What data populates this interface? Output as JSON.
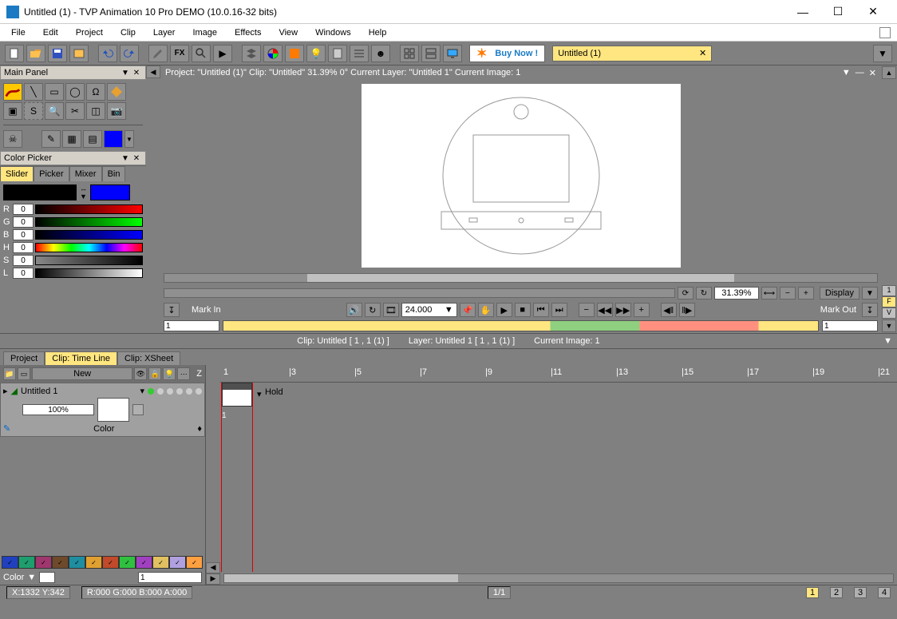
{
  "window": {
    "title": "Untitled (1) - TVP Animation 10 Pro DEMO (10.0.16-32 bits)",
    "min": "—",
    "max": "☐",
    "close": "✕"
  },
  "menus": [
    "File",
    "Edit",
    "Project",
    "Clip",
    "Layer",
    "Image",
    "Effects",
    "View",
    "Windows",
    "Help"
  ],
  "toolbar": {
    "buy_now": "Buy Now !",
    "doc_tab": "Untitled (1)"
  },
  "main_panel": {
    "title": "Main Panel"
  },
  "color_picker": {
    "title": "Color Picker",
    "tabs": [
      "Slider",
      "Picker",
      "Mixer",
      "Bin"
    ],
    "active_tab": "Slider",
    "bg_hex": "#000000",
    "fg_hex": "#0000ff",
    "channels": {
      "R": "0",
      "G": "0",
      "B": "0",
      "H": "0",
      "S": "0",
      "L": "0"
    }
  },
  "canvas": {
    "info": "Project:  \"Untitled (1)\"  Clip: \"Untitled\"   31.39%   0°   Current Layer: \"Untitled 1\"   Current Image: 1",
    "zoom_pct": "31.39%",
    "display_btn": "Display"
  },
  "playbar": {
    "mark_in": "Mark In",
    "mark_out": "Mark Out",
    "fps": "24.000",
    "frame_in": "1",
    "frame_out": "1"
  },
  "infobar": {
    "clip": "Clip: Untitled [ 1 , 1  (1) ]",
    "layer": "Layer: Untitled 1 [ 1 , 1  (1) ]",
    "image": "Current Image: 1"
  },
  "timeline_tabs": [
    "Project",
    "Clip: Time Line",
    "Clip: XSheet"
  ],
  "timeline_active": "Clip: Time Line",
  "layer_panel": {
    "new_btn": "New",
    "z_label": "Z",
    "layer_name": "Untitled 1",
    "opacity": "100%",
    "mode": "Color",
    "hold": "Hold"
  },
  "swatches": [
    "#2040c0",
    "#1e9e6e",
    "#a0366e",
    "#6e4a2a",
    "#1e8ea0",
    "#e0a030",
    "#c04a2a",
    "#30c040",
    "#a040c0",
    "#e0c060",
    "#b0a0e0",
    "#ffa040"
  ],
  "color_row": {
    "label": "Color",
    "value": "1"
  },
  "ruler_ticks": [
    1,
    3,
    5,
    7,
    9,
    11,
    13,
    15,
    17,
    19,
    21
  ],
  "status": {
    "xy": "X:1332  Y:342",
    "rgba": "R:000 G:000 B:000 A:000",
    "frames": "1/1",
    "pages": [
      "1",
      "2",
      "3",
      "4"
    ],
    "active_page": "1"
  }
}
